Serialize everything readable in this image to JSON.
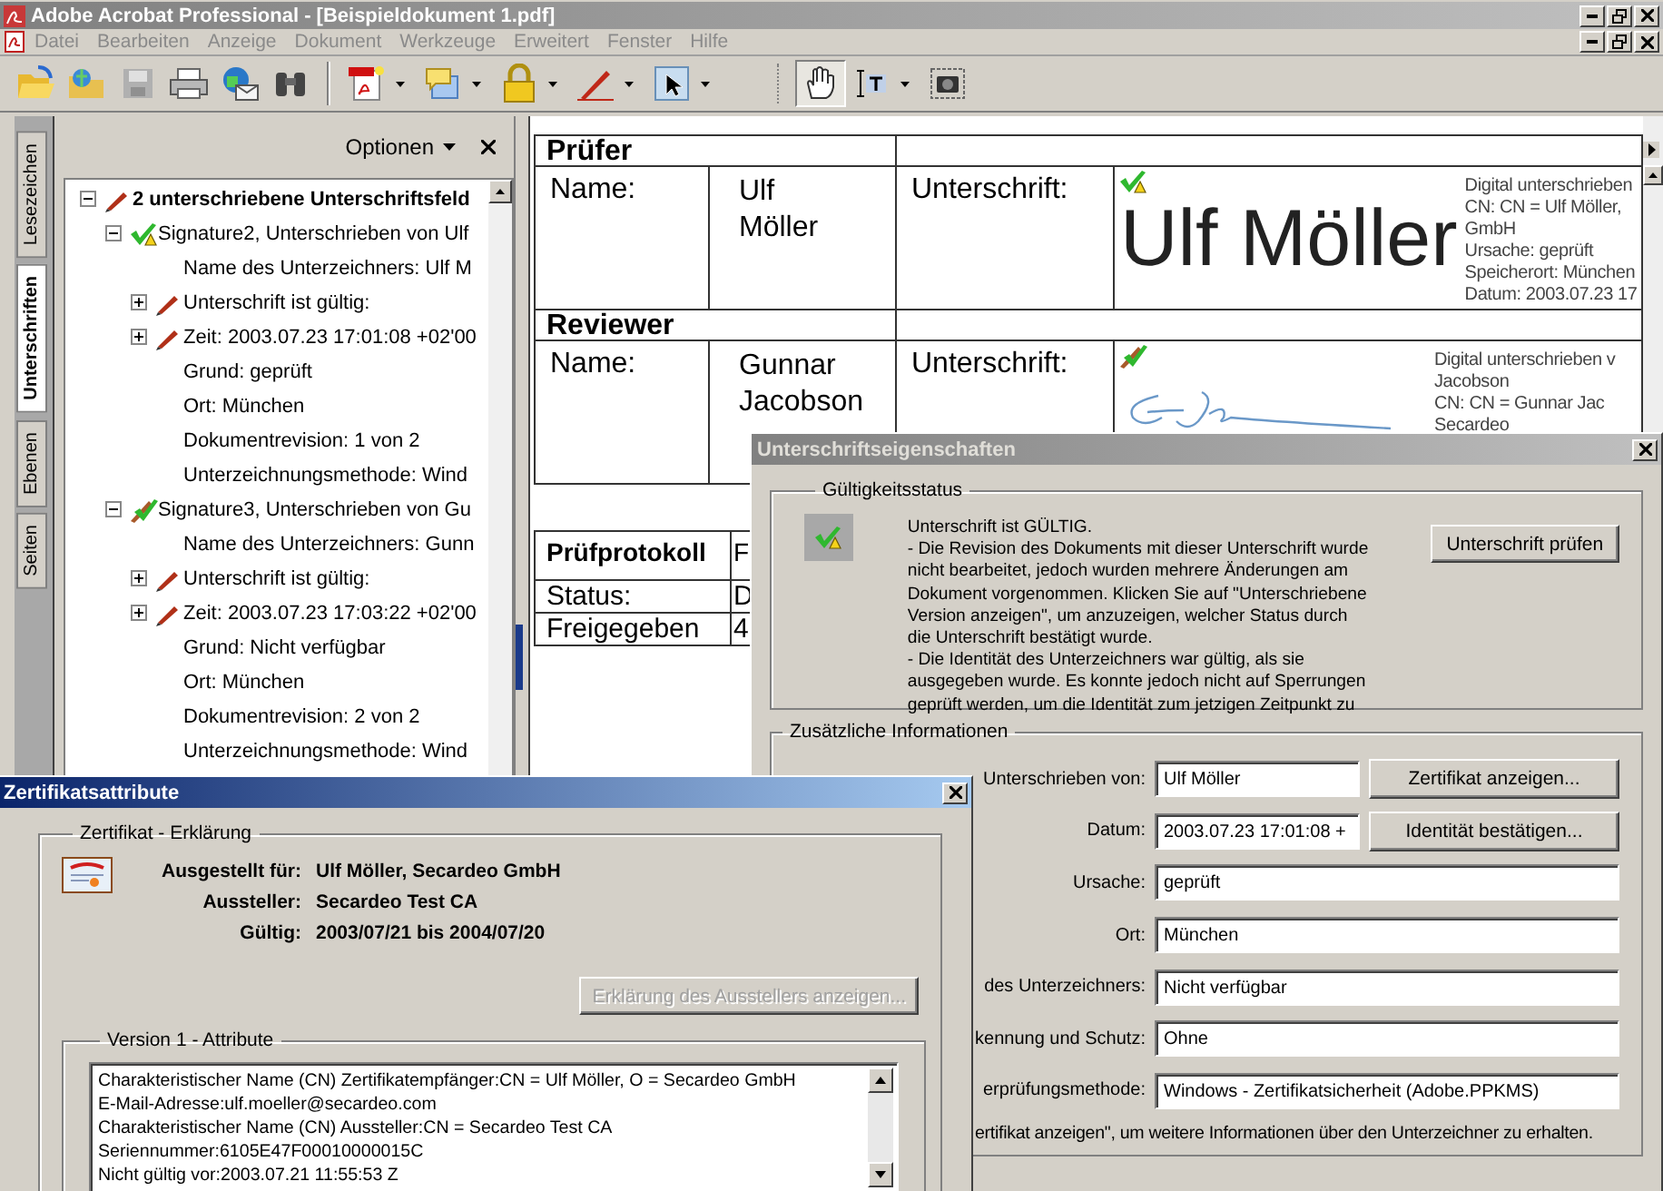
{
  "window": {
    "title": "Adobe Acrobat Professional - [Beispieldokument 1.pdf]"
  },
  "menu": [
    "Datei",
    "Bearbeiten",
    "Anzeige",
    "Dokument",
    "Werkzeuge",
    "Erweitert",
    "Fenster",
    "Hilfe"
  ],
  "tools": [
    {
      "kind": "hand",
      "selected": true
    },
    {
      "kind": "text-select",
      "selected": false
    },
    {
      "kind": "snapshot",
      "selected": false
    }
  ],
  "nav_tabs": [
    {
      "label": "Lesezeichen",
      "selected": false
    },
    {
      "label": "Unterschriften",
      "selected": true
    },
    {
      "label": "Ebenen",
      "selected": false
    },
    {
      "label": "Seiten",
      "selected": false
    }
  ],
  "signatures_panel": {
    "options": "Optionen",
    "tree": [
      {
        "label": "2 unterschriebene Unterschriftsfeld",
        "kind": "field",
        "expanded": true,
        "children": [
          {
            "label": "Signature2, Unterschrieben von Ulf",
            "kind": "sig-warning",
            "expanded": true,
            "children": [
              {
                "label": "Name des Unterzeichners: Ulf M",
                "kind": "text"
              },
              {
                "label": "Unterschrift ist gültig:",
                "kind": "pen",
                "expanded": false
              },
              {
                "label": "Zeit: 2003.07.23 17:01:08 +02'00",
                "kind": "pen",
                "expanded": false
              },
              {
                "label": "Grund: geprüft",
                "kind": "text"
              },
              {
                "label": "Ort: München",
                "kind": "text"
              },
              {
                "label": "Dokumentrevision: 1 von 2",
                "kind": "text"
              },
              {
                "label": "Unterzeichnungsmethode: Wind",
                "kind": "text"
              }
            ]
          },
          {
            "label": "Signature3, Unterschrieben von Gu",
            "kind": "sig-valid",
            "expanded": true,
            "children": [
              {
                "label": "Name des Unterzeichners: Gunn",
                "kind": "text"
              },
              {
                "label": "Unterschrift ist gültig:",
                "kind": "pen",
                "expanded": false
              },
              {
                "label": "Zeit: 2003.07.23 17:03:22 +02'00",
                "kind": "pen",
                "expanded": false
              },
              {
                "label": "Grund: Nicht verfügbar",
                "kind": "text"
              },
              {
                "label": "Ort: München",
                "kind": "text"
              },
              {
                "label": "Dokumentrevision: 2 von 2",
                "kind": "text"
              },
              {
                "label": "Unterzeichnungsmethode: Wind",
                "kind": "text"
              }
            ]
          }
        ]
      }
    ]
  },
  "document": {
    "reviewers": [
      {
        "heading": "Prüfer",
        "name_label": "Name:",
        "name": "Ulf Möller",
        "signature_label": "Unterschrift:",
        "status": {
          "kind": "warning"
        },
        "appearance": {
          "kind": "text",
          "text": "Ulf Möller"
        },
        "details": [
          "Digital unterschrieben",
          "CN: CN = Ulf Möller,",
          "GmbH",
          "Ursache: geprüft",
          "Speicherort: München",
          "Datum: 2003.07.23 17"
        ]
      },
      {
        "heading": "Reviewer",
        "name_label": "Name:",
        "name": "Gunnar Jacobson",
        "signature_label": "Unterschrift:",
        "status": {
          "kind": "valid"
        },
        "appearance": {
          "kind": "handwriting"
        },
        "details": [
          "Digital unterschrieben v",
          "Jacobson",
          "CN: CN = Gunnar Jac",
          "Secardeo"
        ]
      }
    ],
    "protocol": {
      "heading": "Prüfprotokoll",
      "column_2": "F",
      "rows": [
        {
          "label": "Status:",
          "column_2": "D"
        },
        {
          "label": "Freigegeben",
          "column_2": "4"
        }
      ]
    }
  },
  "signature_properties": {
    "title": "Unterschriftseigenschaften",
    "validity": {
      "legend": "Gültigkeitsstatus",
      "status": {
        "kind": "warning"
      },
      "text": "Unterschrift ist GÜLTIG.\n- Die Revision des Dokuments mit dieser Unterschrift wurde\nnicht bearbeitet, jedoch wurden mehrere Änderungen am\nDokument vorgenommen. Klicken Sie auf \"Unterschriebene\nVersion anzeigen\", um anzuzeigen, welcher Status durch\ndie Unterschrift bestätigt wurde.\n- Die Identität des Unterzeichners war gültig, als sie\nausgegeben wurde. Es konnte jedoch nicht auf Sperrungen\ngeprüft werden, um die Identität zum jetzigen Zeitpunkt zu",
      "button": "Unterschrift prüfen"
    },
    "info": {
      "legend": "Zusätzliche Informationen",
      "fields": [
        {
          "label": "Unterschrieben von:",
          "value": "Ulf Möller",
          "button": "Zertifikat anzeigen..."
        },
        {
          "label": "Datum:",
          "value": "2003.07.23 17:01:08 +",
          "button": "Identität bestätigen..."
        },
        {
          "label": "Ursache:",
          "value": "geprüft"
        },
        {
          "label": "Ort:",
          "value": "München"
        },
        {
          "label": "des Unterzeichners:",
          "value": "Nicht verfügbar"
        },
        {
          "label": "kennung und Schutz:",
          "value": "Ohne"
        },
        {
          "label": "erprüfungsmethode:",
          "value": "Windows - Zertifikatsicherheit (Adobe.PPKMS)"
        }
      ],
      "note": "ertifikat anzeigen\", um weitere Informationen über den Unterzeichner zu erhalten."
    }
  },
  "certificate": {
    "title": "Zertifikatsattribute",
    "legend": "Zertifikat - Erklärung",
    "rows": [
      {
        "label": "Ausgestellt für:",
        "value": "Ulf Möller, Secardeo GmbH"
      },
      {
        "label": "Aussteller:",
        "value": "Secardeo Test CA"
      },
      {
        "label": "Gültig:",
        "value": "2003/07/21 bis 2004/07/20"
      }
    ],
    "button": {
      "label": "Erklärung des Ausstellers anzeigen...",
      "disabled": true
    },
    "attributes": {
      "legend": "Version 1 - Attribute",
      "lines": [
        "Charakteristischer Name (CN) Zertifikatempfänger:CN = Ulf Möller, O = Secardeo GmbH",
        "E-Mail-Adresse:ulf.moeller@secardeo.com",
        "Charakteristischer Name (CN) Aussteller:CN = Secardeo Test CA",
        "Seriennummer:6105E47F00010000015C",
        "Nicht gültig vor:2003.07.21 11:55:53 Z"
      ]
    }
  }
}
